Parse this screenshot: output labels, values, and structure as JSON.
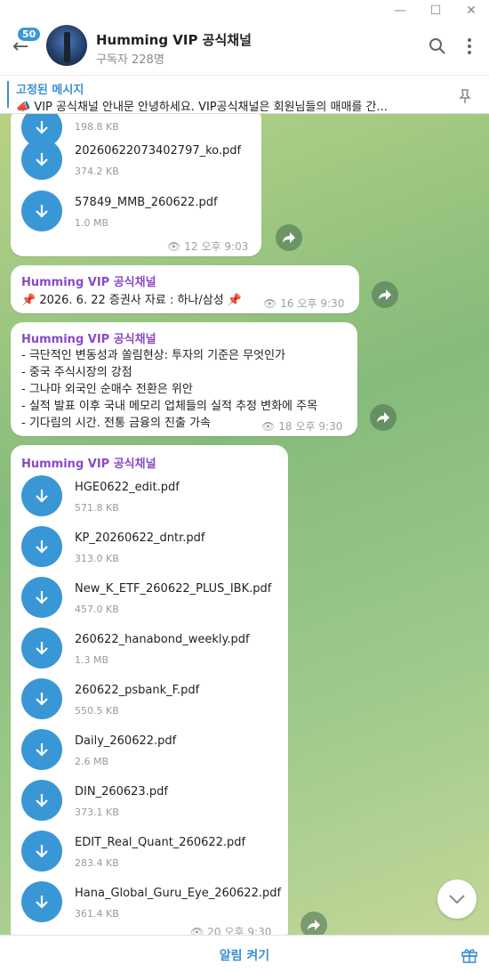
{
  "header": {
    "unread_count": "50",
    "title": "Humming VIP 공식채널",
    "subtitle": "구독자 228명"
  },
  "pinned": {
    "title": "고정된 메시지",
    "text": "📣 VIP 공식채널 안내문  안녕하세요.  VIP공식채널은 회원님들의 매매를 간..."
  },
  "message1": {
    "files": [
      {
        "name": "",
        "size": "198.8 KB"
      },
      {
        "name": "20260622073402797_ko.pdf",
        "size": "374.2 KB"
      },
      {
        "name": "57849_MMB_260622.pdf",
        "size": "1.0 MB"
      }
    ],
    "views": "12",
    "time": "오후 9:03"
  },
  "message2": {
    "sender": "Humming VIP 공식채널",
    "text": "📌 2026. 6. 22 증권사 자료 : 하나/삼성 📌",
    "views": "16",
    "time": "오후 9:30"
  },
  "message3": {
    "sender": "Humming VIP 공식채널",
    "lines": [
      "- 극단적인 변동성과 쏠림현상: 투자의 기준은 무엇인가",
      "- 중국 주식시장의 강점",
      "- 그나마 외국인 순매수 전환은 위안",
      "- 실적 발표 이후 국내 메모리 업체들의 실적 추정 변화에 주목",
      "- 기다림의 시간. 전통 금융의 진출 가속"
    ],
    "views": "18",
    "time": "오후 9:30"
  },
  "message4": {
    "sender": "Humming VIP 공식채널",
    "files": [
      {
        "name": "HGE0622_edit.pdf",
        "size": "571.8 KB"
      },
      {
        "name": "KP_20260622_dntr.pdf",
        "size": "313.0 KB"
      },
      {
        "name": "New_K_ETF_260622_PLUS_IBK.pdf",
        "size": "457.0 KB"
      },
      {
        "name": "260622_hanabond_weekly.pdf",
        "size": "1.3 MB"
      },
      {
        "name": "260622_psbank_F.pdf",
        "size": "550.5 KB"
      },
      {
        "name": "Daily_260622.pdf",
        "size": "2.6 MB"
      },
      {
        "name": "DIN_260623.pdf",
        "size": "373.1 KB"
      },
      {
        "name": "EDIT_Real_Quant_260622.pdf",
        "size": "283.4 KB"
      },
      {
        "name": "Hana_Global_Guru_Eye_260622.pdf",
        "size": "361.4 KB"
      }
    ],
    "views": "20",
    "time": "오후 9:30"
  },
  "bottom": {
    "mute_label": "알림 켜기"
  },
  "colors": {
    "accent": "#3a97d6",
    "sender": "#8a4ac6",
    "header_bg": "#ffffff"
  }
}
